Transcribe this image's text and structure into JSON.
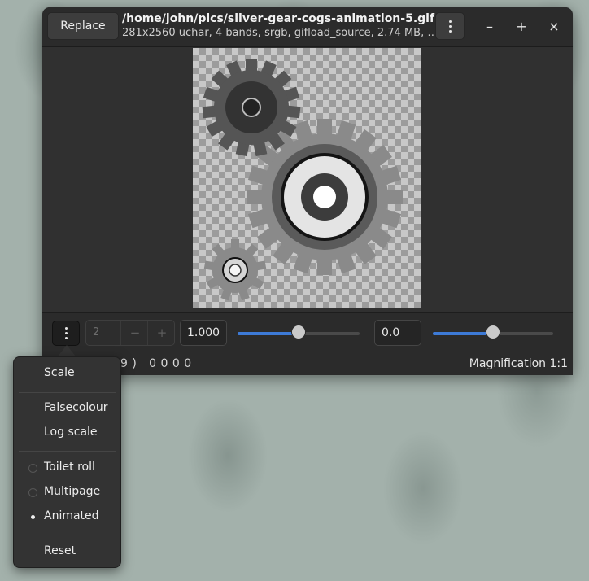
{
  "window": {
    "replace_label": "Replace",
    "title": "/home/john/pics/silver-gear-cogs-animation-5.gif",
    "subtitle": "281x2560 uchar, 4 bands, srgb, gifload_source, 2.74 MB, …",
    "minimize": "–",
    "maximize": "+",
    "close": "×"
  },
  "toolbar": {
    "page_value": "2",
    "minus": "−",
    "plus": "+",
    "scale_value": "1.000",
    "scale_slider_fraction": 0.5,
    "offset_value": "0.0",
    "offset_slider_fraction": 0.5
  },
  "status": {
    "coords": "9 )   0 0 0 0",
    "magnification": "Magnification 1:1"
  },
  "menu": {
    "scale": "Scale",
    "falsecolour": "Falsecolour",
    "log_scale": "Log scale",
    "toilet_roll": "Toilet roll",
    "multipage": "Multipage",
    "animated": "Animated",
    "selected_mode": "Animated",
    "reset": "Reset"
  },
  "colors": {
    "accent": "#3d7ad6",
    "window_bg": "#303030",
    "header_bg": "#2b2b2b"
  },
  "icons": [
    "kebab-menu-icon",
    "minimize-icon",
    "maximize-icon",
    "close-icon"
  ]
}
